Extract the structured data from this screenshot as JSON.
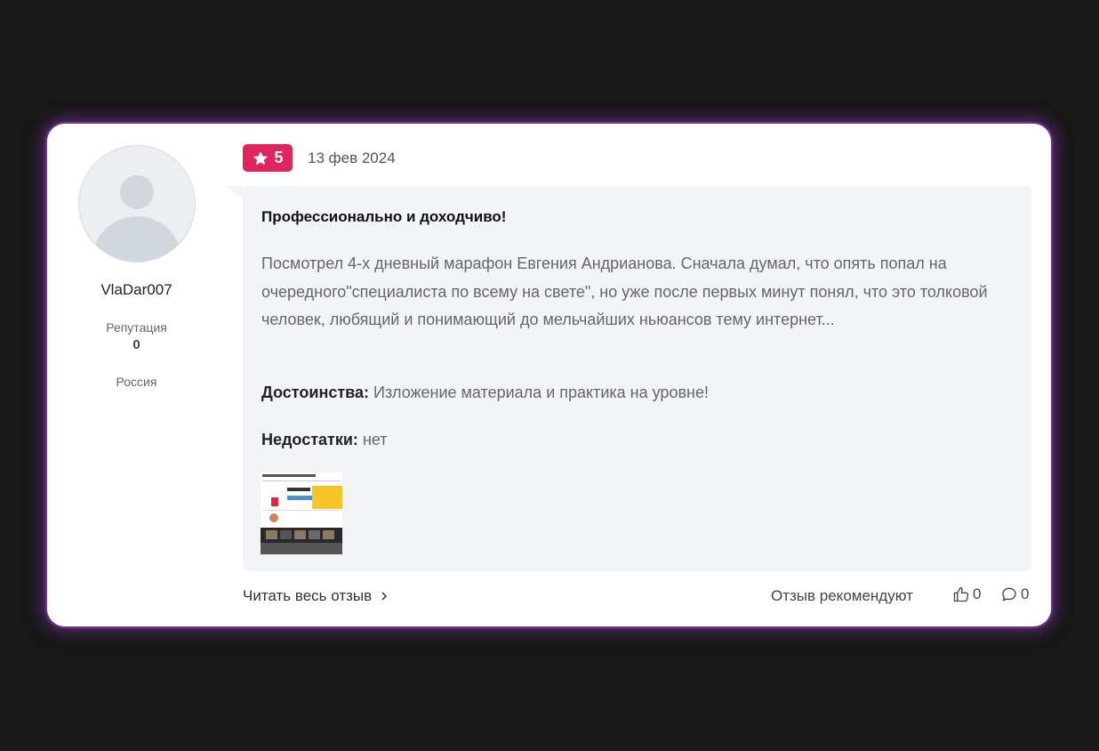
{
  "review": {
    "user": {
      "username": "VlaDar007",
      "reputation_label": "Репутация",
      "reputation_value": "0",
      "country": "Россия"
    },
    "rating": "5",
    "date": "13 фев 2024",
    "title": "Профессионально и доходчиво!",
    "text": "Посмотрел 4-х дневный марафон Евгения Андрианова. Сначала думал, что опять попал на очередного\"специалиста по всему на свете\", но уже после первых минут понял, что это толковой человек, любящий и понимающий до мельчайших ньюансов тему интернет...",
    "pros_label": "Достоинства:",
    "pros_text": "Изложение материала и практика на уровне!",
    "cons_label": "Недостатки:",
    "cons_text": "нет",
    "footer": {
      "read_more": "Читать весь отзыв",
      "recommend_label": "Отзыв рекомендуют",
      "likes": "0",
      "comments": "0"
    }
  },
  "icons": {
    "rating": "star-icon",
    "read_more": "chevron-right-icon",
    "likes": "thumbs-up-icon",
    "comments": "comment-icon"
  },
  "colors": {
    "background": "#181818",
    "card": "#ffffff",
    "glow": "#a03cd2",
    "rating_badge": "#e0245e",
    "bubble": "#f3f4f7"
  }
}
